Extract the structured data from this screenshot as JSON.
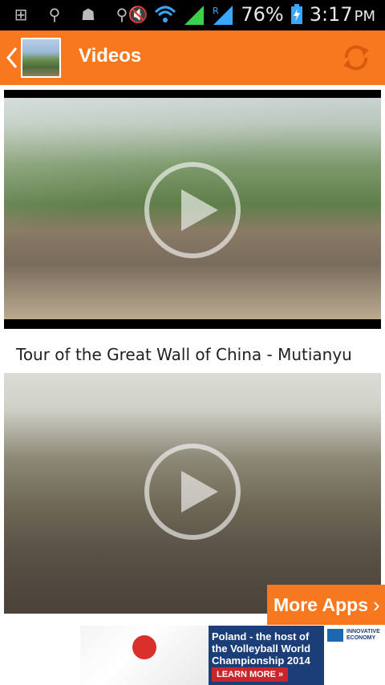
{
  "status_bar": {
    "battery_percent": "76%",
    "time": "3:17",
    "ampm": "PM",
    "roaming": "R"
  },
  "app_bar": {
    "title": "Videos",
    "back_icon": "chevron-left-icon",
    "refresh_icon": "refresh-icon"
  },
  "videos": [
    {
      "title": ""
    },
    {
      "title": "Tour of the Great Wall of China - Mutianyu"
    }
  ],
  "more_apps": {
    "label": "More Apps"
  },
  "ad": {
    "headline": "Poland - the host of the Volleyball World Championship 2014",
    "cta": "LEARN MORE",
    "logo_text": "INNOVATIVE ECONOMY"
  },
  "colors": {
    "accent": "#f7781e",
    "status_bar": "#000000"
  }
}
